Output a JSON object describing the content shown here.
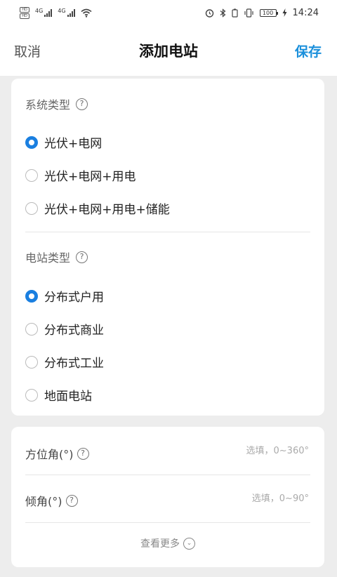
{
  "status_bar": {
    "sim1": "HD",
    "sim2": "HD",
    "net1": "4G",
    "net2": "4G",
    "battery": "100",
    "time": "14:24"
  },
  "nav": {
    "cancel": "取消",
    "title": "添加电站",
    "save": "保存"
  },
  "system_type": {
    "title": "系统类型",
    "help": "?",
    "options": [
      {
        "label": "光伏+电网",
        "selected": true
      },
      {
        "label": "光伏+电网+用电",
        "selected": false
      },
      {
        "label": "光伏+电网+用电+储能",
        "selected": false
      }
    ]
  },
  "station_type": {
    "title": "电站类型",
    "help": "?",
    "options": [
      {
        "label": "分布式户用",
        "selected": true
      },
      {
        "label": "分布式商业",
        "selected": false
      },
      {
        "label": "分布式工业",
        "selected": false
      },
      {
        "label": "地面电站",
        "selected": false
      }
    ]
  },
  "fields": {
    "azimuth": {
      "label": "方位角(°)",
      "placeholder": "选填，0~360°"
    },
    "tilt": {
      "label": "倾角(°)",
      "placeholder": "选填，0~90°"
    }
  },
  "more": {
    "label": "查看更多"
  },
  "colors": {
    "accent": "#1a7fe0",
    "save_link": "#1a8fdb"
  }
}
